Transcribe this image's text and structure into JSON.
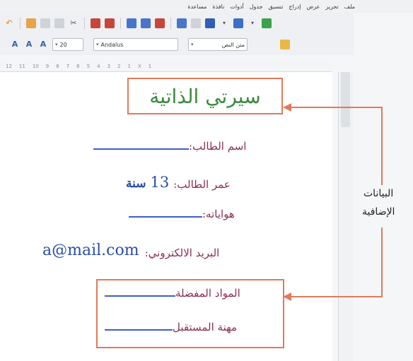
{
  "menu": {
    "items": [
      "ملف",
      "تحرير",
      "عرض",
      "إدراج",
      "تنسيق",
      "جدول",
      "أدوات",
      "نافذة",
      "مساعدة"
    ]
  },
  "toolbar": {
    "font_size_value": "20",
    "font_name_value": "Andalus",
    "paragraph_style_value": "متن النص"
  },
  "ruler": {
    "ticks": [
      "12",
      "11",
      "10",
      "9",
      "8",
      "7",
      "6",
      "5",
      "4",
      "3",
      "2",
      "1",
      "X",
      "1"
    ]
  },
  "document": {
    "title": "سيرتي الذاتية",
    "fields": {
      "student_name_label": "اسم الطالب:",
      "student_age_label": "عمر الطالب:",
      "student_age_value": "13",
      "student_age_unit": "سنة",
      "hobbies_label": "هواياته:",
      "email_label": "البريد الالكتروني:",
      "email_value": "a@mail.com",
      "favorite_subjects_label": "المواد المفضلة",
      "future_career_label": "مهنة المستقبل"
    }
  },
  "annotation": {
    "line1": "البيانات",
    "line2": "الإضافية",
    "color": "#e07a5a"
  }
}
